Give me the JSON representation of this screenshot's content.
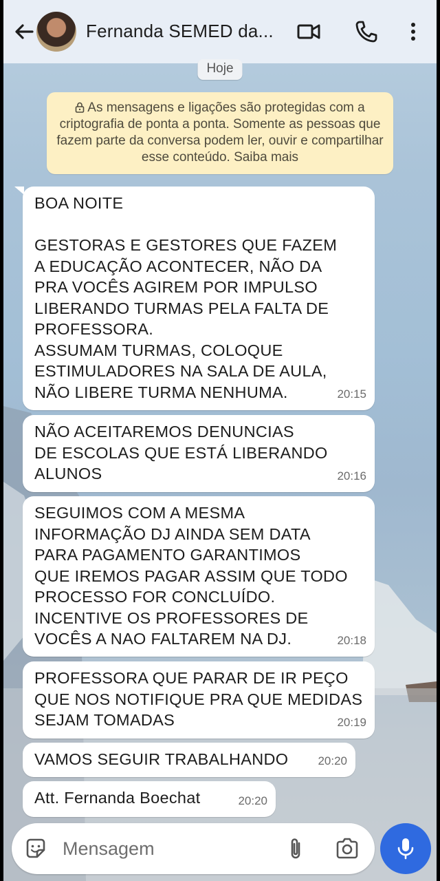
{
  "header": {
    "title": "Fernanda SEMED da...",
    "icons": [
      "back-arrow-icon",
      "avatar",
      "video-call-icon",
      "phone-icon",
      "more-vert-icon"
    ]
  },
  "date_chip": "Hoje",
  "encryption_notice": "As mensagens e ligações são protegidas com a criptografia de ponta a ponta. Somente as pessoas que fazem parte da conversa podem ler, ouvir e compartilhar esse conteúdo. Saiba mais",
  "messages": [
    {
      "text": "BOA NOITE\n\nGESTORAS E GESTORES QUE FAZEM\nA EDUCAÇÃO ACONTECER, NÃO DA\nPRA VOCÊS AGIREM POR IMPULSO\nLIBERANDO TURMAS PELA FALTA DE\nPROFESSORA.\nASSUMAM TURMAS, COLOQUE\nESTIMULADORES NA SALA DE AULA,\nNÃO LIBERE TURMA NENHUMA.",
      "time": "20:15"
    },
    {
      "text": "NÃO ACEITAREMOS DENUNCIAS\nDE ESCOLAS QUE ESTÁ LIBERANDO\nALUNOS",
      "time": "20:16"
    },
    {
      "text": "SEGUIMOS COM A MESMA\nINFORMAÇÃO DJ AINDA SEM DATA\nPARA PAGAMENTO GARANTIMOS\nQUE IREMOS PAGAR ASSIM QUE TODO\nPROCESSO FOR CONCLUÍDO.\nINCENTIVE OS PROFESSORES DE\nVOCÊS A NAO FALTAREM NA DJ.",
      "time": "20:18"
    },
    {
      "text": "PROFESSORA QUE PARAR DE IR PEÇO\nQUE NOS NOTIFIQUE PRA QUE MEDIDAS\nSEJAM TOMADAS",
      "time": "20:19"
    },
    {
      "text": "VAMOS SEGUIR TRABALHANDO",
      "time": "20:20"
    },
    {
      "text": "Att. Fernanda Boechat",
      "time": "20:20"
    }
  ],
  "composer": {
    "placeholder": "Mensagem",
    "icons": [
      "sticker-icon",
      "attach-icon",
      "camera-icon",
      "mic-icon"
    ]
  },
  "colors": {
    "header_bg": "#e8eef6",
    "notice_bg": "#fdf0c4",
    "bubble_bg": "#ffffff",
    "mic_button": "#2f6ae0"
  }
}
